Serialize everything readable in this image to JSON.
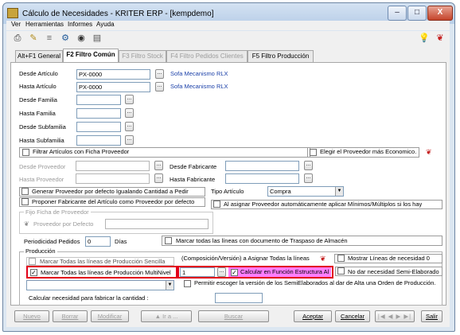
{
  "window": {
    "title": "Cálculo de Necesidades - KRITER ERP - [kempdemo]",
    "min": "–",
    "max": "□",
    "close": "X"
  },
  "menu": [
    "Ver",
    "Herramientas",
    "Informes",
    "Ayuda"
  ],
  "tabs": [
    {
      "label": "Alt+F1 General"
    },
    {
      "label": "F2 Filtro Común"
    },
    {
      "label": "F3 Filtro Stock"
    },
    {
      "label": "F4 Filtro Pedidos Clientes"
    },
    {
      "label": "F5 Filtro Producción"
    }
  ],
  "filters": {
    "desde_articulo": {
      "label": "Desde Artículo",
      "value": "PX-0000",
      "desc": "Sofa Mecanismo RLX"
    },
    "hasta_articulo": {
      "label": "Hasta Artículo",
      "value": "PX-0000",
      "desc": "Sofa Mecanismo RLX"
    },
    "desde_familia": "Desde Familia",
    "hasta_familia": "Hasta Familia",
    "desde_subfamilia": "Desde Subfamilia",
    "hasta_subfamilia": "Hasta Subfamilia",
    "filtrar_ficha": "Filtrar Artículos con Ficha Proveedor",
    "elegir_proveedor": "Elegir el Proveedor más Economico.",
    "desde_proveedor": "Desde Proveedor",
    "hasta_proveedor": "Hasta Proveedor",
    "desde_fabricante": "Desde Fabricante",
    "hasta_fabricante": "Hasta Fabricante",
    "generar_proveedor": "Generar Proveedor por defecto Igualando Cantidad a Pedir",
    "proponer_fabricante": "Proponer Fabricante del Artículo como Proveedor por defecto",
    "tipo_articulo_label": "Tipo Artículo",
    "tipo_articulo_value": "Compra",
    "al_asignar": "Al asignar Proveedor automáticamente aplicar Mínimos/Múltiplos si los hay",
    "fijo_ficha": "Fijo Ficha de Proveedor",
    "proveedor_defecto": "Proveedor por Defecto",
    "periodicidad_label": "Periodicidad Pedidos",
    "periodicidad_value": "0",
    "dias": "Días",
    "marcar_traspaso": "Marcar todas las líneas con documento de Traspaso de Almacén"
  },
  "produccion": {
    "group": "Producción",
    "marcar_sencilla": "Marcar Todas las líneas de Producción Sencilla",
    "comp_version": "(Composición/Versión) a Asignar Todas la líneas",
    "mostrar_lineas": "Mostrar Líneas de necesidad 0",
    "marcar_multinivel": "Marcar Todas las líneas de Producción MultiNivel",
    "multinivel_value": "1",
    "calcular_estructura": "Calcular en Función Estructura Al",
    "no_dar_necesidad": "No dar necesidad Semi-Elaborado",
    "permitir_escoger": "Permitir escoger la versión de los SemiElaborados al dar de Alta una Orden de Producción.",
    "calcular_cantidad": "Calcular necesidad para fabricar la cantidad :"
  },
  "buttons": {
    "nuevo": "Nuevo",
    "borrar": "Borrar",
    "modificar": "Modificar",
    "ir_a": "Ir a ...",
    "buscar": "Buscar",
    "aceptar": "Aceptar",
    "cancelar": "Cancelar",
    "salir": "Salir",
    "dots": "..."
  },
  "colors": {
    "accent_red": "#e2001a",
    "link_blue": "#1a3fa8",
    "highlight_pink": "#ff7dff"
  }
}
